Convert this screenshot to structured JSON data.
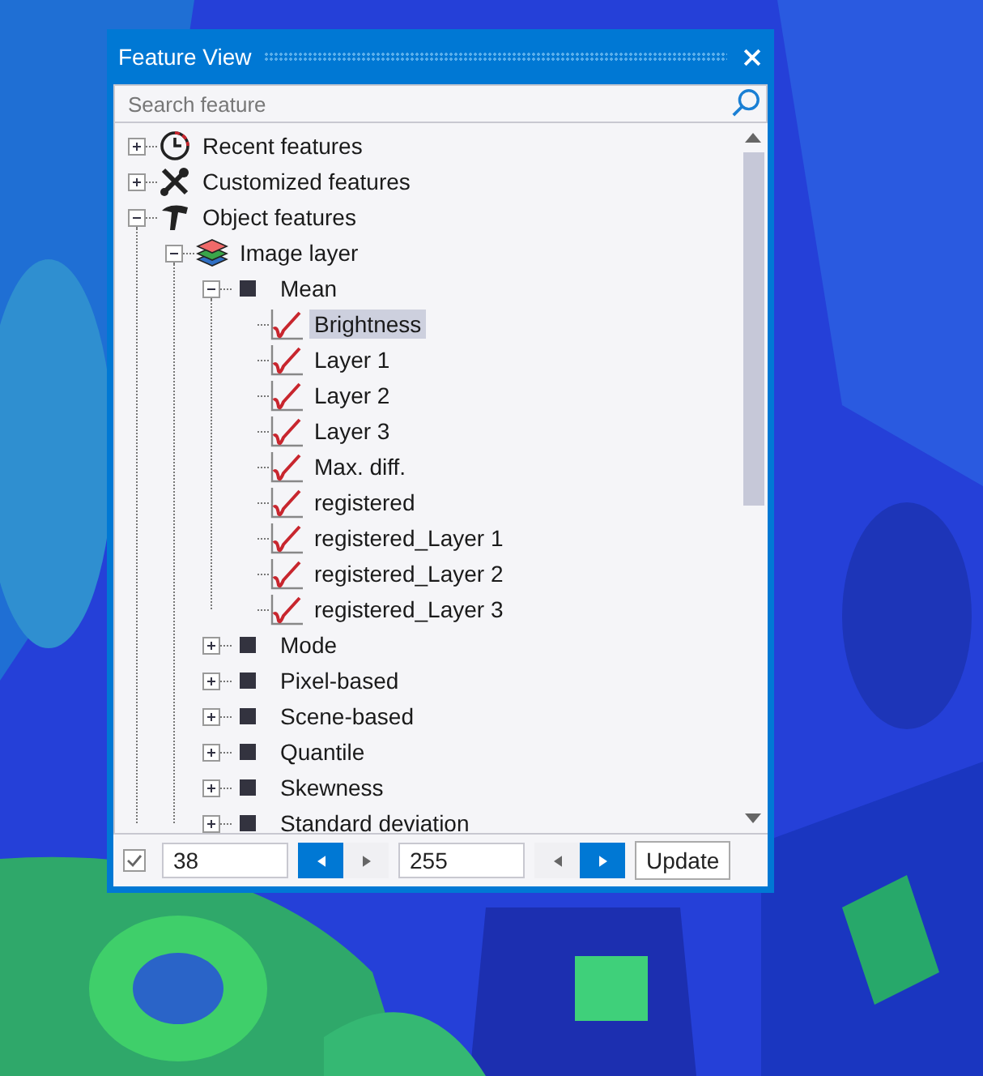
{
  "window": {
    "title": "Feature View"
  },
  "search": {
    "placeholder": "Search feature"
  },
  "tree": {
    "items": [
      {
        "label": "Recent features",
        "kind": "clock",
        "expanded": false,
        "selected": false
      },
      {
        "label": "Customized features",
        "kind": "tools",
        "expanded": false,
        "selected": false
      },
      {
        "label": "Object features",
        "kind": "hammer",
        "expanded": true,
        "selected": false,
        "children": [
          {
            "label": "Image layer",
            "kind": "layers",
            "expanded": true,
            "selected": false,
            "children": [
              {
                "label": "Mean",
                "kind": "square",
                "expanded": true,
                "selected": false,
                "children": [
                  {
                    "label": "Brightness",
                    "kind": "chart",
                    "selected": true
                  },
                  {
                    "label": "Layer 1",
                    "kind": "chart",
                    "selected": false
                  },
                  {
                    "label": "Layer 2",
                    "kind": "chart",
                    "selected": false
                  },
                  {
                    "label": "Layer 3",
                    "kind": "chart",
                    "selected": false
                  },
                  {
                    "label": "Max. diff.",
                    "kind": "chart",
                    "selected": false
                  },
                  {
                    "label": "registered",
                    "kind": "chart",
                    "selected": false
                  },
                  {
                    "label": "registered_Layer 1",
                    "kind": "chart",
                    "selected": false
                  },
                  {
                    "label": "registered_Layer 2",
                    "kind": "chart",
                    "selected": false
                  },
                  {
                    "label": "registered_Layer 3",
                    "kind": "chart",
                    "selected": false
                  }
                ]
              },
              {
                "label": "Mode",
                "kind": "square",
                "expanded": false,
                "selected": false
              },
              {
                "label": "Pixel-based",
                "kind": "square",
                "expanded": false,
                "selected": false
              },
              {
                "label": "Scene-based",
                "kind": "square",
                "expanded": false,
                "selected": false
              },
              {
                "label": "Quantile",
                "kind": "square",
                "expanded": false,
                "selected": false
              },
              {
                "label": "Skewness",
                "kind": "square",
                "expanded": false,
                "selected": false
              },
              {
                "label": "Standard deviation",
                "kind": "square",
                "expanded": false,
                "selected": false
              }
            ]
          }
        ]
      }
    ]
  },
  "range_bar": {
    "checked": true,
    "min_value": "38",
    "min_arrows": [
      {
        "kind": "left",
        "highlighted": true
      },
      {
        "kind": "right",
        "highlighted": false
      }
    ],
    "max_value": "255",
    "max_arrows": [
      {
        "kind": "left",
        "highlighted": false
      },
      {
        "kind": "right",
        "highlighted": true
      }
    ],
    "update_button": "Update"
  }
}
